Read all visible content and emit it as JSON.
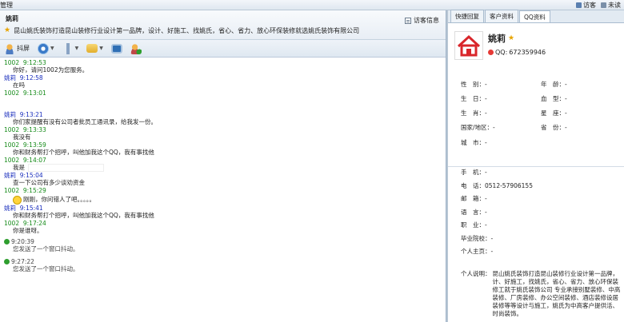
{
  "window": {
    "title": "管理"
  },
  "topbar": {
    "visitor_label": "访客",
    "unread_label": "未读"
  },
  "chat": {
    "contact_name": "姚莉",
    "signature": "昆山姚氏装饰打造昆山装修行业设计第一品牌，设计、好施工、找姚氏，省心、省力、放心环保装修就选姚氏装饰有限公司",
    "visitor_info_label": "访客信息",
    "toolbar": {
      "vibrate_label": "抖屏"
    },
    "messages": [
      {
        "sender": "1002",
        "time": "9:12:53",
        "text": "你好，请问1002为您服务。",
        "mine": true
      },
      {
        "sender": "1002",
        "time": "9:12:58",
        "text": "在吗",
        "mine": false
      },
      {
        "sender": "1002",
        "time": "9:13:01",
        "text": "",
        "mine": true
      },
      {
        "sender": "姚莉",
        "time": "9:13:21",
        "text": "你们家提醒有没有公司者批员工通讯录，给我发一份。",
        "mine": false
      },
      {
        "sender": "1002",
        "time": "9:13:33",
        "text": "我没有",
        "mine": true
      },
      {
        "sender": "1002",
        "time": "9:13:59",
        "text": "你和财务帮打个招呼，叫他加我这个QQ，我有事找他",
        "mine": true
      },
      {
        "sender": "1002",
        "time": "9:14:07",
        "text": "我是",
        "mine": true
      },
      {
        "sender": "姚莉",
        "time": "9:15:04",
        "text": "查一下公司有多少谈劝资金",
        "mine": false
      },
      {
        "sender": "1002",
        "time": "9:15:29",
        "text": "刚刚，你问错人了吧。。。。。",
        "mine": true
      },
      {
        "sender": "姚莉",
        "time": "9:15:41",
        "text": "你和财务帮打个招呼，叫他加我这个QQ，我有事找他",
        "mine": false
      },
      {
        "sender": "1002",
        "time": "9:17:24",
        "text": "你是谁呀。",
        "mine": true
      }
    ],
    "system_messages": [
      {
        "time": "9:20:39",
        "text": "您发送了一个窗口抖动。"
      },
      {
        "time": "9:27:22",
        "text": "您发送了一个窗口抖动。"
      }
    ]
  },
  "side": {
    "tabs": [
      "快捷回复",
      "客户资料",
      "QQ资料"
    ],
    "name": "姚莉",
    "qq_label": "QQ:",
    "qq_number": "672359946",
    "fields": {
      "gender_label": "性　别：",
      "gender": "-",
      "age_label": "年　龄：",
      "age": "-",
      "birthday_label": "生　日：",
      "birthday": "-",
      "blood_label": "血　型：",
      "blood": "-",
      "zodiac_label": "生　肖：",
      "zodiac": "-",
      "constellation_label": "星　座：",
      "constellation": "-",
      "country_label": "国家/地区：",
      "country": "-",
      "province_label": "省　份：",
      "province": "-",
      "city_label": "城　市：",
      "city": "-"
    },
    "contact": {
      "mobile_label": "手　机：",
      "mobile": "-",
      "phone_label": "电　话：",
      "phone": "0512-57906155",
      "email_label": "邮　箱：",
      "email": "-",
      "language_label": "语　言：",
      "language": "-",
      "job_label": "职　业：",
      "job": "-",
      "school_label": "毕业院校：",
      "school": "-",
      "homepage_label": "个人主页：",
      "homepage": "-",
      "desc_label": "个人说明：",
      "desc": "昆山姚氏装饰打造昆山装修行业设计第一品牌，计、好施工，找姚氏，省心、省力、放心环保装修工就于姚氏装饰公司 专业承接别墅装修、中高装修、厂房装修、办公空间装修、酒店装修设居装修等等设计与施工，姚氏为中高客户提供活、时尚装饰。"
    }
  },
  "colors": {
    "mine": "#148a18",
    "theirs": "#1a2ebd",
    "accent": "#e53935"
  }
}
